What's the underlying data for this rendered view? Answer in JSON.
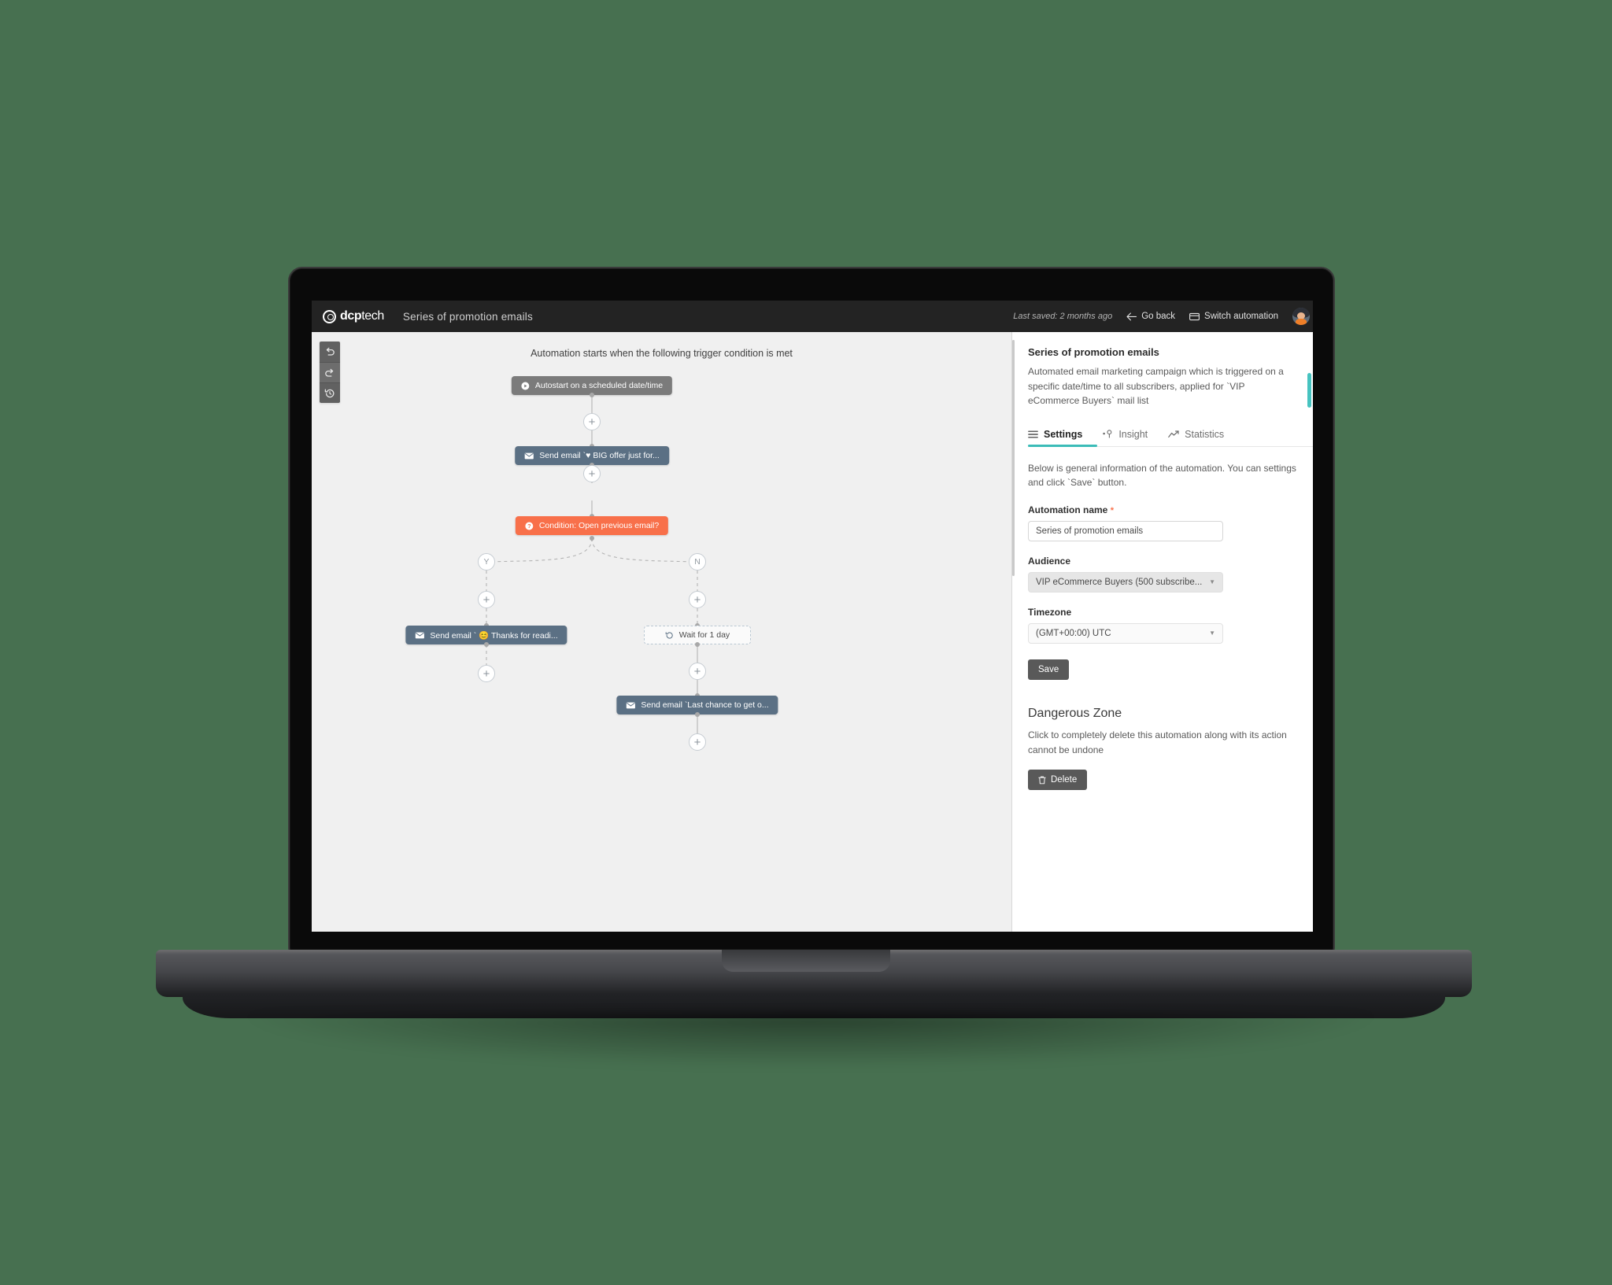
{
  "header": {
    "brand_bold": "dcp",
    "brand_light": "tech",
    "title": "Series of promotion emails",
    "last_saved": "Last saved: 2 months ago",
    "go_back": "Go back",
    "switch_automation": "Switch automation"
  },
  "toolbar": {
    "undo": "Undo",
    "redo": "Redo",
    "history": "History"
  },
  "canvas": {
    "caption": "Automation starts when the following trigger condition is met",
    "nodes": [
      {
        "id": "trigger",
        "type": "trigger",
        "label": "Autostart on a scheduled date/time",
        "icon": "play-circle-icon"
      },
      {
        "id": "email1",
        "type": "email",
        "label": "Send email `♥ BIG offer just for...",
        "icon": "envelope-icon"
      },
      {
        "id": "condition",
        "type": "condition",
        "label": "Condition: Open previous email?",
        "icon": "question-circle-icon"
      },
      {
        "id": "email2",
        "type": "email",
        "label": "Send email ` 😊 Thanks for readi...",
        "icon": "envelope-icon"
      },
      {
        "id": "wait",
        "type": "wait",
        "label": "Wait for 1 day",
        "icon": "clock-rewind-icon"
      },
      {
        "id": "email3",
        "type": "email",
        "label": "Send email `Last chance to get o...",
        "icon": "envelope-icon"
      }
    ],
    "branch_yes": "Y",
    "branch_no": "N",
    "add_label": "+"
  },
  "panel": {
    "title": "Series of promotion emails",
    "description": "Automated email marketing campaign which is triggered on a specific date/time to all subscribers, applied for `VIP eCommerce Buyers` mail list",
    "tabs": [
      {
        "label": "Settings",
        "icon": "list-icon",
        "active": true
      },
      {
        "label": "Insight",
        "icon": "insight-icon",
        "active": false
      },
      {
        "label": "Statistics",
        "icon": "chart-line-icon",
        "active": false
      }
    ],
    "help_text": "Below is general information of the automation. You can settings and click `Save` button.",
    "fields": {
      "name_label": "Automation name",
      "name_required": "*",
      "name_value": "Series of promotion emails",
      "audience_label": "Audience",
      "audience_value": "VIP eCommerce Buyers (500 subscribe...",
      "timezone_label": "Timezone",
      "timezone_value": "(GMT+00:00) UTC"
    },
    "save_label": "Save",
    "danger_title": "Dangerous Zone",
    "danger_text": "Click to completely delete this automation along with its action cannot be undone",
    "delete_label": "Delete"
  },
  "colors": {
    "accent_teal": "#3bbcb8",
    "condition_orange": "#f8704a",
    "email_slate": "#5b7084",
    "trigger_gray": "#7b7b7b",
    "header_dark": "#232323",
    "page_background": "#477050"
  }
}
